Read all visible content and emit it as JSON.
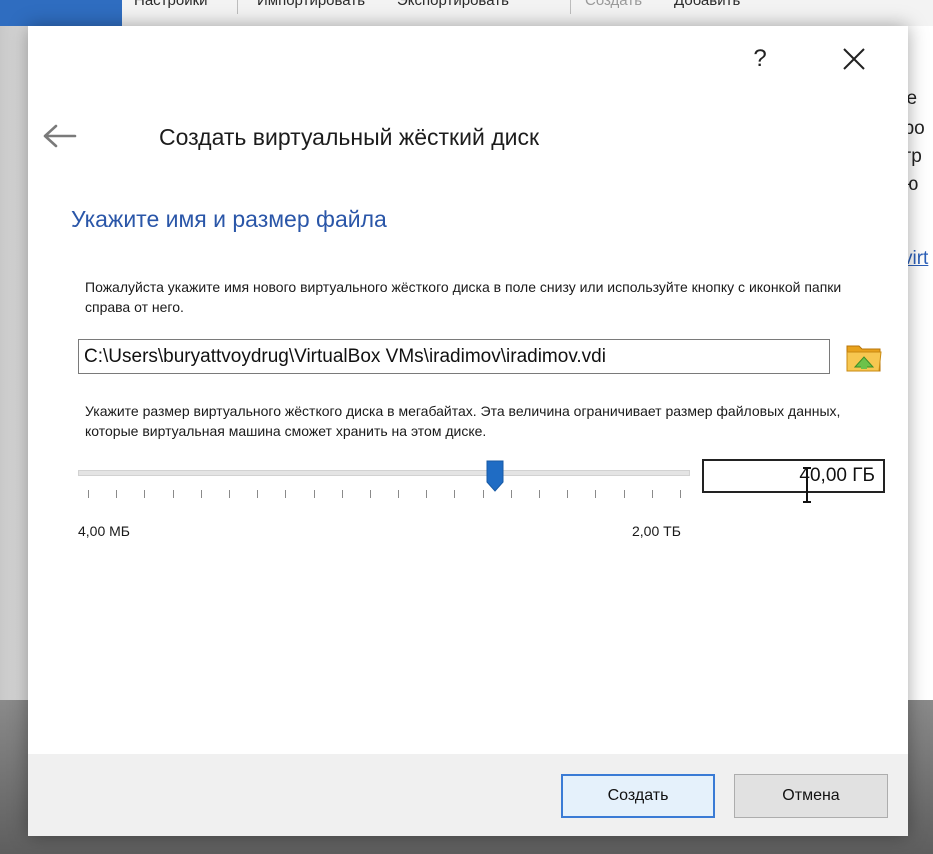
{
  "background": {
    "toolbar": [
      {
        "label": "Настройки",
        "disabled": false
      },
      {
        "label": "Импортировать",
        "disabled": false
      },
      {
        "label": "Экспортировать",
        "disabled": false
      },
      {
        "label": "Создать",
        "disabled": true
      },
      {
        "label": "Добавить",
        "disabled": false
      }
    ],
    "right_fragments": [
      "ке",
      "иро",
      "стр",
      "лю",
      "virt"
    ]
  },
  "dialog": {
    "help_label": "?",
    "header_title": "Создать виртуальный жёсткий диск",
    "section_title": "Укажите имя и размер файла",
    "file_description": "Пожалуйста укажите имя нового виртуального жёсткого диска в поле снизу или используйте кнопку с иконкой папки справа от него.",
    "file_path": "C:\\Users\\buryattvoydrug\\VirtualBox VMs\\iradimov\\iradimov.vdi",
    "size_description": "Укажите размер виртуального жёсткого диска в мегабайтах. Эта величина ограничивает размер файловых данных, которые виртуальная машина сможет хранить на этом диске.",
    "size": {
      "value_text": "40,00 ГБ",
      "min_label": "4,00 МБ",
      "max_label": "2,00 ТБ",
      "slider_fraction": 0.688,
      "tick_count": 22
    },
    "buttons": {
      "create": "Создать",
      "cancel": "Отмена"
    }
  },
  "colors": {
    "accent": "#2a56a8",
    "slider_thumb": "#1f6cc4",
    "primary_button_border": "#3a7bd5"
  }
}
